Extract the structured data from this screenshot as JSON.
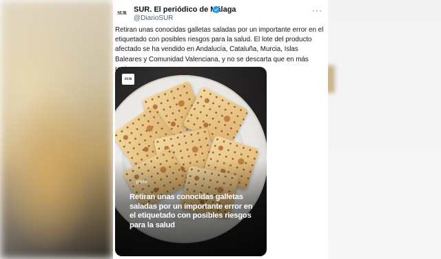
{
  "account": {
    "avatar_text": "SUR",
    "display_name": "SUR. El periódico de Málaga",
    "handle": "@DiarioSUR",
    "verified_icon": "verified-badge-icon",
    "more_icon": "more-options-icon"
  },
  "tweet": {
    "text": "Retiran unas conocidas galletas saladas por un importante error en el etiquetado con posibles riesgos para la salud. El lote del producto afectado se ha vendido en Andalucía, Cataluña, Murcia, Islas Baleares y Comunidad Valenciana, y no se descarta que en más regiones."
  },
  "media": {
    "badge_text": "SUR",
    "watermark": "gitreli",
    "headline": "Retiran unas conocidas galletas saladas por un importante error en el etiquetado con posibles riesgos para la salud"
  },
  "colors": {
    "text_primary": "#0f1419",
    "text_secondary": "#536471",
    "verified_blue": "#1d9bf0"
  }
}
